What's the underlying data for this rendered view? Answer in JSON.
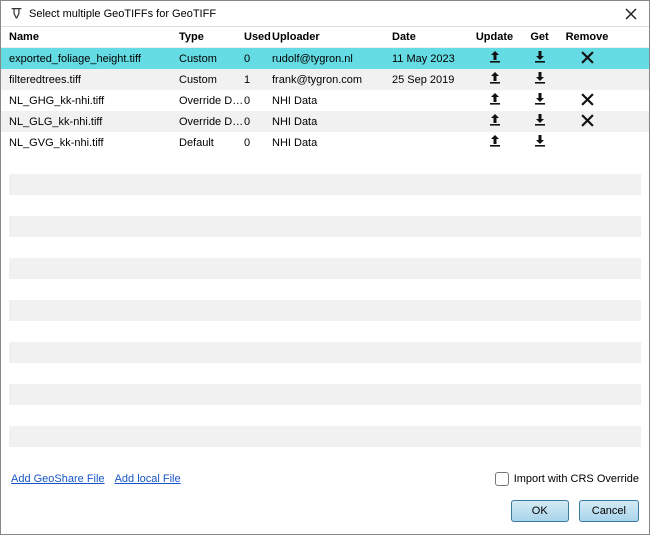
{
  "window": {
    "title": "Select multiple GeoTIFFs for GeoTIFF"
  },
  "columns": {
    "name": "Name",
    "type": "Type",
    "used": "Used",
    "uploader": "Uploader",
    "date": "Date",
    "update": "Update",
    "get": "Get",
    "remove": "Remove"
  },
  "rows": [
    {
      "name": "exported_foliage_height.tiff",
      "type": "Custom",
      "used": "0",
      "uploader": "rudolf@tygron.nl",
      "date": "11 May 2023",
      "update": true,
      "get": true,
      "remove": true,
      "selected": true
    },
    {
      "name": "filteredtrees.tiff",
      "type": "Custom",
      "used": "1",
      "uploader": "frank@tygron.com",
      "date": "25 Sep 2019",
      "update": true,
      "get": true,
      "remove": false,
      "selected": false
    },
    {
      "name": "NL_GHG_kk-nhi.tiff",
      "type": "Override De...",
      "used": "0",
      "uploader": "NHI Data",
      "date": "",
      "update": true,
      "get": true,
      "remove": true,
      "selected": false
    },
    {
      "name": "NL_GLG_kk-nhi.tiff",
      "type": "Override De...",
      "used": "0",
      "uploader": "NHI Data",
      "date": "",
      "update": true,
      "get": true,
      "remove": true,
      "selected": false
    },
    {
      "name": "NL_GVG_kk-nhi.tiff",
      "type": "Default",
      "used": "0",
      "uploader": "NHI Data",
      "date": "",
      "update": true,
      "get": true,
      "remove": false,
      "selected": false
    }
  ],
  "links": {
    "addGeoShare": "Add GeoShare File",
    "addLocal": "Add local File"
  },
  "checkbox": {
    "crsOverrideLabel": "Import with CRS Override"
  },
  "buttons": {
    "ok": "OK",
    "cancel": "Cancel"
  }
}
